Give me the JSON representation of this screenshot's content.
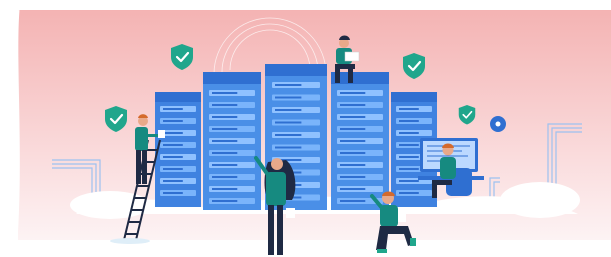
{
  "illustration": {
    "subject": "",
    "colors": {
      "bg_top": "#f4b3b3",
      "bg_bottom": "#fdeff0",
      "server_light": "#4a8fe7",
      "server_dark": "#2f6fd1",
      "server_slot": "#8fc1ff",
      "shield": "#20a68c",
      "outfit": "#168a80",
      "dark": "#1f2a44",
      "skin": "#e8a98a",
      "hair_orange": "#d46a2c",
      "cloud": "#ffffff",
      "accent": "#2f6fd1"
    },
    "icons": [
      "shield-check-icon",
      "shield-check-icon",
      "shield-check-icon",
      "shield-check-icon",
      "target-dot-icon"
    ]
  }
}
